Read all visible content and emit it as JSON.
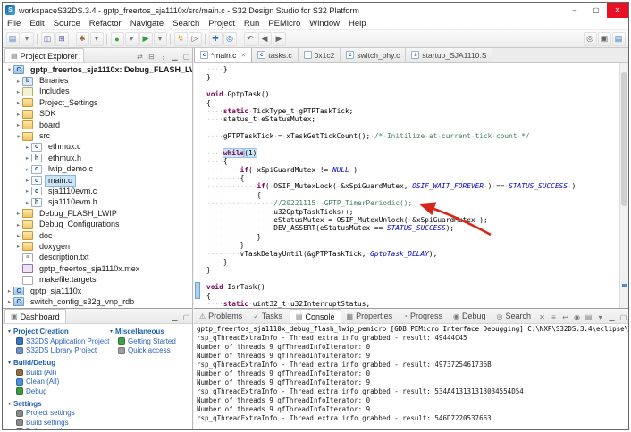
{
  "window": {
    "title": "workspaceS32DS.3.4 - gptp_freertos_sja1110x/src/main.c - S32 Design Studio for S32 Platform",
    "app_icon": "S",
    "controls": [
      {
        "name": "minimize",
        "glyph": "–"
      },
      {
        "name": "maximize",
        "glyph": "▢"
      },
      {
        "name": "close",
        "glyph": "✕"
      }
    ]
  },
  "menubar": [
    "File",
    "Edit",
    "Source",
    "Refactor",
    "Navigate",
    "Search",
    "Project",
    "Run",
    "PEMicro",
    "Window",
    "Help"
  ],
  "toolbar": [
    {
      "name": "new",
      "glyph": "▤",
      "color": "#4a7ab5"
    },
    {
      "name": "new-dropdown",
      "glyph": "▾",
      "color": "#777777"
    },
    {
      "type": "sep"
    },
    {
      "name": "save",
      "glyph": "◫",
      "color": "#5f5f9f"
    },
    {
      "name": "save-all",
      "glyph": "⊞",
      "color": "#5f5f9f"
    },
    {
      "type": "sep"
    },
    {
      "name": "build-all",
      "glyph": "✱",
      "color": "#8d6e3f"
    },
    {
      "name": "build-dropdown",
      "glyph": "▾",
      "color": "#777777"
    },
    {
      "type": "sep"
    },
    {
      "name": "debug",
      "glyph": "●",
      "color": "#3f9b42"
    },
    {
      "name": "debug-dropdown",
      "glyph": "▾",
      "color": "#777777"
    },
    {
      "name": "run",
      "glyph": "▶",
      "color": "#2f9e44"
    },
    {
      "name": "run-dropdown",
      "glyph": "▾",
      "color": "#777777"
    },
    {
      "type": "sep"
    },
    {
      "name": "flash-programmer",
      "glyph": "↯",
      "color": "#d88a00"
    },
    {
      "name": "external-tools",
      "glyph": "▷",
      "color": "#666666"
    },
    {
      "type": "sep"
    },
    {
      "name": "new-wizard",
      "glyph": "✚",
      "color": "#2d6cb5"
    },
    {
      "name": "search",
      "glyph": "◎",
      "color": "#2d6cb5"
    },
    {
      "type": "sep"
    },
    {
      "name": "last-edit",
      "glyph": "↶",
      "color": "#666666"
    },
    {
      "name": "back",
      "glyph": "◀",
      "color": "#666666"
    },
    {
      "name": "forward",
      "glyph": "▶",
      "color": "#666666"
    },
    {
      "type": "spacer"
    },
    {
      "name": "quick-access-search",
      "glyph": "◎",
      "color": "#666666"
    },
    {
      "name": "perspective-debug",
      "glyph": "▣",
      "color": "#666666"
    },
    {
      "name": "perspective-cpp",
      "glyph": "▤",
      "color": "#2d6cb5"
    }
  ],
  "project_explorer": {
    "title": "Project Explorer",
    "header_icons": [
      {
        "name": "link-with-editor",
        "glyph": "⇄"
      },
      {
        "name": "collapse-all",
        "glyph": "⊟"
      },
      {
        "name": "view-menu",
        "glyph": "⋮"
      },
      {
        "name": "minimize",
        "glyph": "▁"
      },
      {
        "name": "maximize",
        "glyph": "▢"
      }
    ],
    "tree": [
      {
        "d": 0,
        "a": "o",
        "i": "proj",
        "l": "gptp_freertos_sja1110x: Debug_FLASH_LWIP",
        "bold": true
      },
      {
        "d": 1,
        "a": "c",
        "i": "bin",
        "l": "Binaries"
      },
      {
        "d": 1,
        "a": "c",
        "i": "inc",
        "l": "Includes"
      },
      {
        "d": 1,
        "a": "c",
        "i": "folder",
        "l": "Project_Settings"
      },
      {
        "d": 1,
        "a": "c",
        "i": "folder",
        "l": "SDK"
      },
      {
        "d": 1,
        "a": "c",
        "i": "folder",
        "l": "board"
      },
      {
        "d": 1,
        "a": "o",
        "i": "srcfolder",
        "l": "src"
      },
      {
        "d": 2,
        "a": "c",
        "i": "cfile",
        "l": "ethmux.c"
      },
      {
        "d": 2,
        "a": "c",
        "i": "hfile",
        "l": "ethmux.h"
      },
      {
        "d": 2,
        "a": "c",
        "i": "cfile",
        "l": "lwip_demo.c"
      },
      {
        "d": 2,
        "a": "c",
        "i": "cfile",
        "l": "main.c",
        "sel": true
      },
      {
        "d": 2,
        "a": "c",
        "i": "cfile",
        "l": "sja1110evm.c"
      },
      {
        "d": 2,
        "a": "c",
        "i": "hfile",
        "l": "sja1110evm.h"
      },
      {
        "d": 1,
        "a": "c",
        "i": "folder",
        "l": "Debug_FLASH_LWIP"
      },
      {
        "d": 1,
        "a": "c",
        "i": "folder",
        "l": "Debug_Configurations"
      },
      {
        "d": 1,
        "a": "c",
        "i": "folder",
        "l": "doc"
      },
      {
        "d": 1,
        "a": "c",
        "i": "folder",
        "l": "doxygen"
      },
      {
        "d": 1,
        "a": null,
        "i": "txtfile",
        "l": "description.txt"
      },
      {
        "d": 1,
        "a": null,
        "i": "mex",
        "l": "gptp_freertos_sja1110x.mex"
      },
      {
        "d": 1,
        "a": null,
        "i": "file",
        "l": "makefile.targets"
      },
      {
        "d": 0,
        "a": "c",
        "i": "proj",
        "l": "gptp_sja1110x"
      },
      {
        "d": 0,
        "a": "c",
        "i": "proj",
        "l": "switch_config_s32g_vnp_rdb"
      }
    ]
  },
  "dashboard": {
    "title": "Dashboard",
    "header_icons": [
      {
        "name": "minimize",
        "glyph": "▁"
      },
      {
        "name": "maximize",
        "glyph": "▢"
      }
    ],
    "sections_left": [
      {
        "title": "Project Creation",
        "items": [
          {
            "icon": "app-project",
            "label": "S32DS Application Project"
          },
          {
            "icon": "lib-project",
            "label": "S32DS Library Project"
          }
        ]
      },
      {
        "title": "Build/Debug",
        "items": [
          {
            "icon": "build",
            "label": "Build (All)"
          },
          {
            "icon": "clean",
            "label": "Clean (All)"
          },
          {
            "icon": "debug",
            "label": "Debug"
          }
        ]
      },
      {
        "title": "Settings",
        "items": [
          {
            "icon": "settings",
            "label": "Project settings"
          },
          {
            "icon": "settings",
            "label": "Build settings"
          },
          {
            "icon": "settings",
            "label": "Debug settings"
          }
        ]
      }
    ],
    "sections_right": [
      {
        "title": "Miscellaneous",
        "items": [
          {
            "icon": "getting-started",
            "label": "Getting Started"
          },
          {
            "icon": "quick-access",
            "label": "Quick access"
          }
        ]
      }
    ]
  },
  "editor": {
    "tabs": [
      {
        "label": "*main.c",
        "icon": "c",
        "active": true
      },
      {
        "label": "tasks.c",
        "icon": "c"
      },
      {
        "label": "0x1c2",
        "icon": "m"
      },
      {
        "label": "switch_phy.c",
        "icon": "c"
      },
      {
        "label": "startup_SJA1110.S",
        "icon": "s"
      }
    ],
    "code": [
      [
        [
          "    }",
          "p"
        ]
      ],
      [
        [
          "}",
          "p"
        ]
      ],
      [],
      [
        [
          "void",
          "k"
        ],
        [
          " GptpTask()",
          "p"
        ]
      ],
      [
        [
          "{",
          "p"
        ]
      ],
      [
        [
          "    ",
          "p"
        ],
        [
          "static",
          "k"
        ],
        [
          " TickType_t gPTPTaskTick;",
          "p"
        ]
      ],
      [
        [
          "    status_t eStatusMutex;",
          "p"
        ]
      ],
      [],
      [
        [
          "    gPTPTaskTick = xTaskGetTickCount(); ",
          "p"
        ],
        [
          "/* Initilize at current tick count */",
          "c"
        ]
      ],
      [],
      [
        [
          "    ",
          "p"
        ],
        [
          "while",
          "k hl"
        ],
        [
          "(1)",
          "p hl"
        ]
      ],
      [
        [
          "    {",
          "p"
        ]
      ],
      [
        [
          "        ",
          "p"
        ],
        [
          "if",
          "k"
        ],
        [
          "( xSpiGuardMutex != ",
          "p"
        ],
        [
          "NULL",
          "m"
        ],
        [
          " )",
          "p"
        ]
      ],
      [
        [
          "        {",
          "p"
        ]
      ],
      [
        [
          "            ",
          "p"
        ],
        [
          "if",
          "k"
        ],
        [
          "( OSIF_MutexLock( &xSpiGuardMutex, ",
          "p"
        ],
        [
          "OSIF_WAIT_FOREVER",
          "m"
        ],
        [
          " ) == ",
          "p"
        ],
        [
          "STATUS_SUCCESS",
          "m"
        ],
        [
          " )",
          "p"
        ]
      ],
      [
        [
          "            {",
          "p"
        ]
      ],
      [
        [
          "                ",
          "p"
        ],
        [
          "//20221115  GPTP_TimerPeriodic();",
          "c"
        ]
      ],
      [
        [
          "                u32GptpTaskTicks++;",
          "p"
        ]
      ],
      [
        [
          "                eStatusMutex = OSIF_MutexUnlock( &xSpiGuardMutex );",
          "p"
        ]
      ],
      [
        [
          "                DEV_ASSERT(eStatusMutex == ",
          "p"
        ],
        [
          "STATUS_SUCCESS",
          "m"
        ],
        [
          ");",
          "p"
        ]
      ],
      [
        [
          "            }",
          "p"
        ]
      ],
      [
        [
          "        }",
          "p"
        ]
      ],
      [
        [
          "        vTaskDelayUntil(&gPTPTaskTick, ",
          "p"
        ],
        [
          "GptpTask_DELAY",
          "m"
        ],
        [
          ");",
          "p"
        ]
      ],
      [
        [
          "    }",
          "p"
        ]
      ],
      [
        [
          "}",
          "p"
        ]
      ],
      [],
      [
        [
          "void",
          "k"
        ],
        [
          " IsrTask()",
          "p"
        ]
      ],
      [
        [
          "{",
          "p"
        ]
      ],
      [
        [
          "    ",
          "p"
        ],
        [
          "static",
          "k"
        ],
        [
          " uint32_t u32InterruptStatus;",
          "p"
        ]
      ]
    ]
  },
  "console": {
    "tabs": [
      {
        "name": "problems",
        "glyph": "⚠",
        "label": "Problems"
      },
      {
        "name": "tasks",
        "glyph": "✓",
        "label": "Tasks"
      },
      {
        "name": "console",
        "glyph": "▤",
        "label": "Console",
        "active": true
      },
      {
        "name": "properties",
        "glyph": "▦",
        "label": "Properties"
      },
      {
        "name": "progress",
        "glyph": "◔",
        "label": "Progress"
      },
      {
        "name": "debug",
        "glyph": "◉",
        "label": "Debug"
      },
      {
        "name": "search",
        "glyph": "◎",
        "label": "Search"
      }
    ],
    "toolbar_icons": [
      {
        "name": "clear-console",
        "glyph": "✕"
      },
      {
        "name": "scroll-lock",
        "glyph": "≡"
      },
      {
        "name": "word-wrap",
        "glyph": "↩"
      },
      {
        "name": "pin-console",
        "glyph": "◉"
      },
      {
        "name": "display-selected-console",
        "glyph": "▤"
      },
      {
        "name": "open-console-dropdown",
        "glyph": "▾"
      },
      {
        "name": "minimize",
        "glyph": "▁"
      },
      {
        "name": "maximize",
        "glyph": "▢"
      }
    ],
    "banner": "gptp_freertos_sja1110x_debug_flash_lwip_pemicro [GDB PEMicro Interface Debugging] C:\\NXP\\S32DS.3.4\\eclipse\\plugins\\com.pemicro.debug.gdbjtag.pne_5.2.8.202203171549",
    "lines": [
      "rsp_qThreadExtraInfo - Thread extra info grabbed - result: 49444C45",
      "Number of threads 9 qfThreadInfoIterator: 0",
      "Number of threads 9 qfThreadInfoIterator: 9",
      "rsp_qThreadExtraInfo - Thread extra info grabbed - result: 4973725461736B",
      "Number of threads 9 qfThreadInfoIterator: 0",
      "Number of threads 9 qfThreadInfoIterator: 9",
      "rsp_qThreadExtraInfo - Thread extra info grabbed - result: 534A413131313034554D54",
      "Number of threads 9 qfThreadInfoIterator: 0",
      "Number of threads 9 qfThreadInfoIterator: 9",
      "rsp_qThreadExtraInfo - Thread extra info grabbed - result: 546D7220537663"
    ]
  }
}
